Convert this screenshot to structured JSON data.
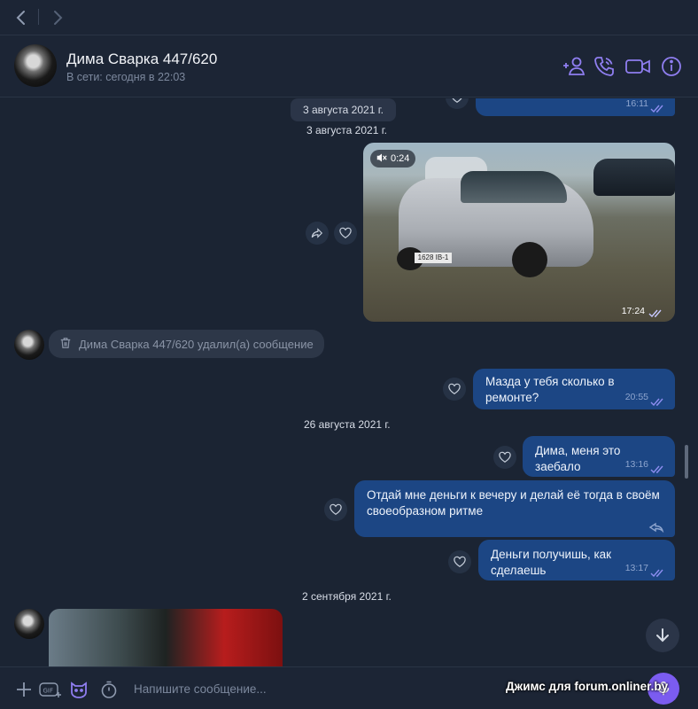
{
  "contact": {
    "name": "Дима Сварка 447/620",
    "status": "В сети: сегодня в 22:03"
  },
  "messages": {
    "top_time": "16:11",
    "date_pill": "3 августа 2021 г.",
    "date_1": "3 августа 2021 г.",
    "video_duration": "0:24",
    "video_time": "17:24",
    "plate_text": "1628 IB-1",
    "deleted_text": "Дима Сварка 447/620 удалил(а) сообщение",
    "m1_text": "Мазда у тебя сколько в ремонте?",
    "m1_time": "20:55",
    "date_2": "26 августа 2021 г.",
    "m2_text": "Дима, меня это заебало",
    "m2_time": "13:16",
    "m3_text": "Отдай мне деньги к вечеру и делай её тогда в своём своеобразном ритме",
    "m4_text": "Деньги получишь, как сделаешь",
    "m4_time": "13:17",
    "date_3": "2 сентября 2021 г."
  },
  "composer": {
    "placeholder": "Напишите сообщение..."
  },
  "watermark": "Джимс для forum.onliner.by",
  "colors": {
    "background": "#1b2433",
    "outgoing_bubble": "#1c4684",
    "accent": "#7b5cf0"
  }
}
